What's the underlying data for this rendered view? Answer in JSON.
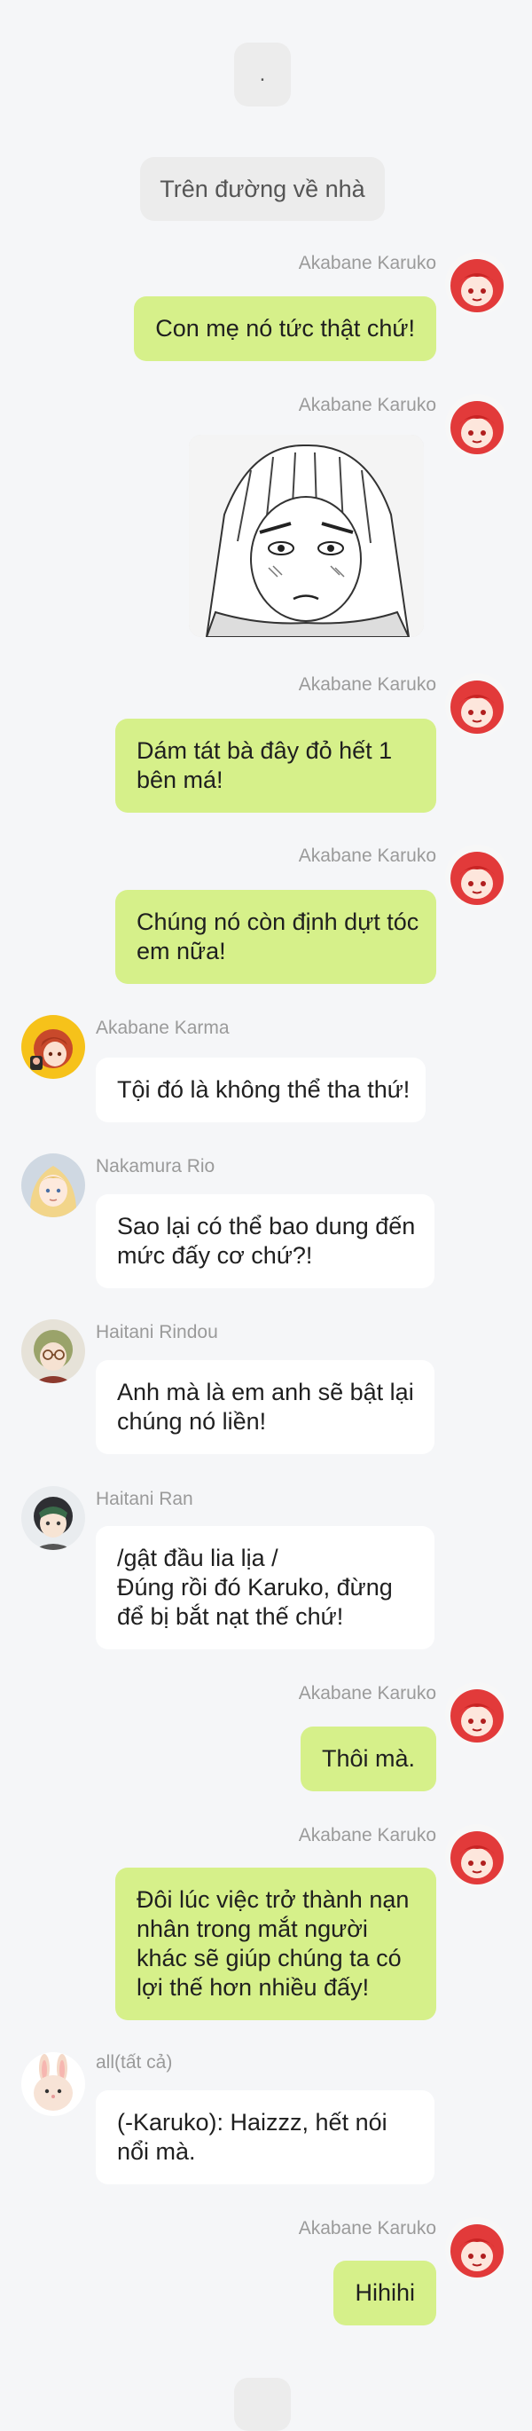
{
  "top_pill": {
    "text": "."
  },
  "scene_pill": {
    "text": "Trên đường về nhà"
  },
  "messages": [
    {
      "sender": "Akabane Karuko",
      "lines": [
        "Con mẹ nó tức thật chứ!"
      ]
    },
    {
      "sender": "Akabane Karuko",
      "image_icon": "manga-character-icon"
    },
    {
      "sender": "Akabane Karuko",
      "lines": [
        "Dám tát bà đây đỏ hết 1",
        "bên má!"
      ]
    },
    {
      "sender": "Akabane Karuko",
      "lines": [
        "Chúng nó còn định dựt tóc",
        "em nữa!"
      ]
    },
    {
      "sender": "Akabane Karma",
      "lines": [
        "Tội đó là không thể tha thứ!"
      ]
    },
    {
      "sender": "Nakamura Rio",
      "lines": [
        "Sao lại có thể bao dung đến",
        "mức đấy cơ chứ?!"
      ]
    },
    {
      "sender": "Haitani Rindou",
      "lines": [
        "Anh mà là em anh sẽ bật lại",
        "chúng nó liền!"
      ]
    },
    {
      "sender": "Haitani Ran",
      "lines": [
        "/gật đầu lia lịa /",
        "Đúng rồi đó Karuko, đừng",
        "để bị bắt nạt thế chứ!"
      ]
    },
    {
      "sender": "Akabane Karuko",
      "lines": [
        "Thôi mà."
      ]
    },
    {
      "sender": "Akabane Karuko",
      "lines": [
        "Đôi lúc việc trở thành nạn",
        "nhân trong mắt người",
        "khác sẽ giúp chúng ta có",
        "lợi thế hơn nhiều đấy!"
      ]
    },
    {
      "sender": "all(tất cả)",
      "lines": [
        "(-Karuko): Haizzz, hết nói",
        "nổi mà."
      ]
    },
    {
      "sender": "Akabane Karuko",
      "lines": [
        "Hihihi"
      ]
    }
  ],
  "colors": {
    "background": "#f5f6f8",
    "outgoing_bubble": "#d6f08a",
    "incoming_bubble": "#ffffff",
    "sender_name": "#9a9a9a"
  }
}
